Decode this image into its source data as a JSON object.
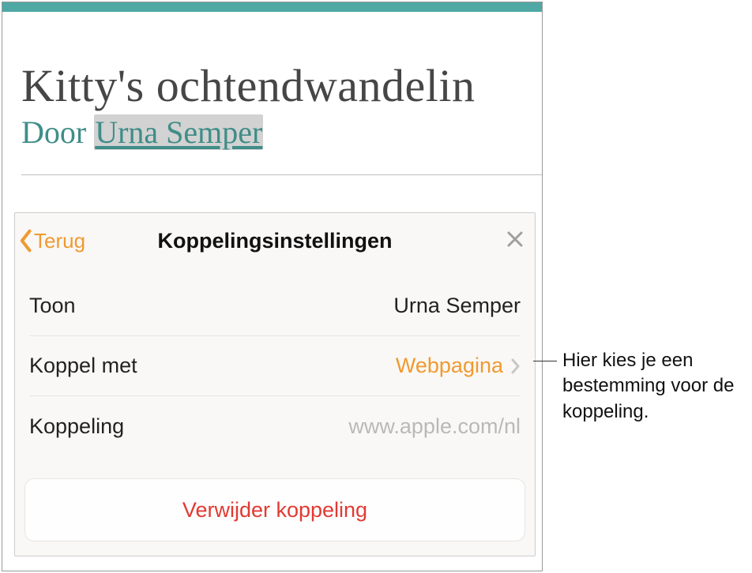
{
  "document": {
    "title": "Kitty's ochtendwandelin",
    "subtitle_prefix": "Door ",
    "linked_text": "Urna Semper"
  },
  "popover": {
    "back_label": "Terug",
    "title": "Koppelingsinstellingen",
    "rows": {
      "display": {
        "label": "Toon",
        "value": "Urna Semper"
      },
      "link_with": {
        "label": "Koppel met",
        "value": "Webpagina"
      },
      "link": {
        "label": "Koppeling",
        "value": "www.apple.com/nl"
      }
    },
    "remove_label": "Verwijder koppeling"
  },
  "callout": {
    "text": "Hier kies je een bestemming voor de koppeling."
  }
}
